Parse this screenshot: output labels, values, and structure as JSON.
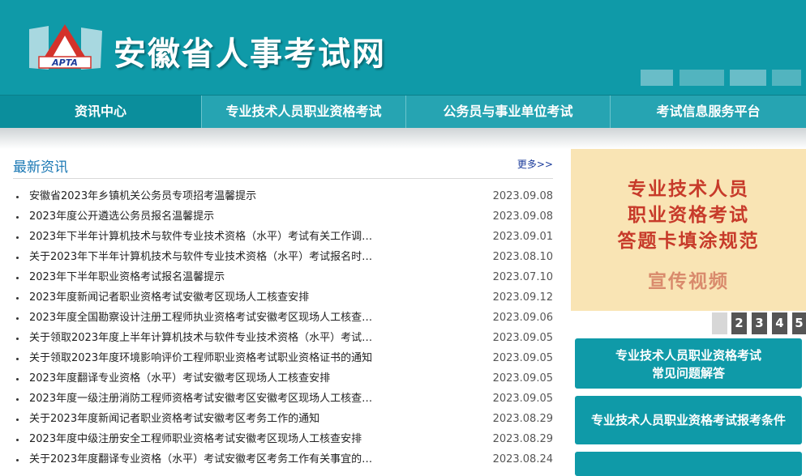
{
  "header": {
    "site_title": "安徽省人事考试网",
    "logo_text": "APTA"
  },
  "nav": [
    {
      "label": "资讯中心"
    },
    {
      "label": "专业技术人员职业资格考试"
    },
    {
      "label": "公务员与事业单位考试"
    },
    {
      "label": "考试信息服务平台"
    }
  ],
  "news": {
    "title": "最新资讯",
    "more": "更多>>",
    "items": [
      {
        "text": "安徽省2023年乡镇机关公务员专项招考温馨提示",
        "date": "2023.09.08"
      },
      {
        "text": "2023年度公开遴选公务员报名温馨提示",
        "date": "2023.09.08"
      },
      {
        "text": "2023年下半年计算机技术与软件专业技术资格（水平）考试有关工作调…",
        "date": "2023.09.01"
      },
      {
        "text": "关于2023年下半年计算机技术与软件专业技术资格（水平）考试报名时…",
        "date": "2023.08.10"
      },
      {
        "text": "2023年下半年职业资格考试报名温馨提示",
        "date": "2023.07.10"
      },
      {
        "text": "2023年度新闻记者职业资格考试安徽考区现场人工核查安排",
        "date": "2023.09.12"
      },
      {
        "text": "2023年度全国勘察设计注册工程师执业资格考试安徽考区现场人工核查…",
        "date": "2023.09.06"
      },
      {
        "text": "关于领取2023年度上半年计算机技术与软件专业技术资格（水平）考试…",
        "date": "2023.09.05"
      },
      {
        "text": "关于领取2023年度环境影响评价工程师职业资格考试职业资格证书的通知",
        "date": "2023.09.05"
      },
      {
        "text": "2023年度翻译专业资格（水平）考试安徽考区现场人工核查安排",
        "date": "2023.09.05"
      },
      {
        "text": "2023年度一级注册消防工程师资格考试安徽考区安徽考区现场人工核查…",
        "date": "2023.09.05"
      },
      {
        "text": "关于2023年度新闻记者职业资格考试安徽考区考务工作的通知",
        "date": "2023.08.29"
      },
      {
        "text": "2023年度中级注册安全工程师职业资格考试安徽考区现场人工核查安排",
        "date": "2023.08.29"
      },
      {
        "text": "关于2023年度翻译专业资格（水平）考试安徽考区考务工作有关事宜的…",
        "date": "2023.08.24"
      }
    ]
  },
  "banner": {
    "line1": "专业技术人员",
    "line2": "职业资格考试",
    "line3": "答题卡填涂规范",
    "line4": "宣传视频"
  },
  "pager": [
    "1",
    "2",
    "3",
    "4",
    "5"
  ],
  "side_buttons": {
    "faq_line1": "专业技术人员职业资格考试",
    "faq_line2": "常见问题解答",
    "conditions": "专业技术人员职业资格考试报考条件"
  },
  "colors": {
    "brand": "#0f9aa8",
    "nav_active": "#0b8e9c",
    "link_blue": "#1a78b4",
    "banner_bg": "#f9e4b4",
    "banner_text": "#c73a2a"
  }
}
